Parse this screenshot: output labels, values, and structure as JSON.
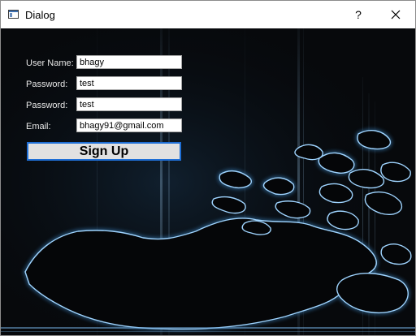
{
  "window": {
    "title": "Dialog",
    "help_glyph": "?",
    "icons": {
      "app": "dialog-window-icon",
      "help": "question-mark-icon",
      "close": "close-icon"
    }
  },
  "form": {
    "username": {
      "label": "User Name:",
      "value": "bhagy"
    },
    "password": {
      "label": "Password:",
      "value": "test"
    },
    "confirm_password": {
      "label": "Password:",
      "value": "test"
    },
    "email": {
      "label": "Email:",
      "value": "bhagy91@gmail.com"
    },
    "submit_label": "Sign Up"
  },
  "colors": {
    "background": "#080a0d",
    "glow": "#6fb6f0",
    "button_border": "#1f6fd6"
  }
}
